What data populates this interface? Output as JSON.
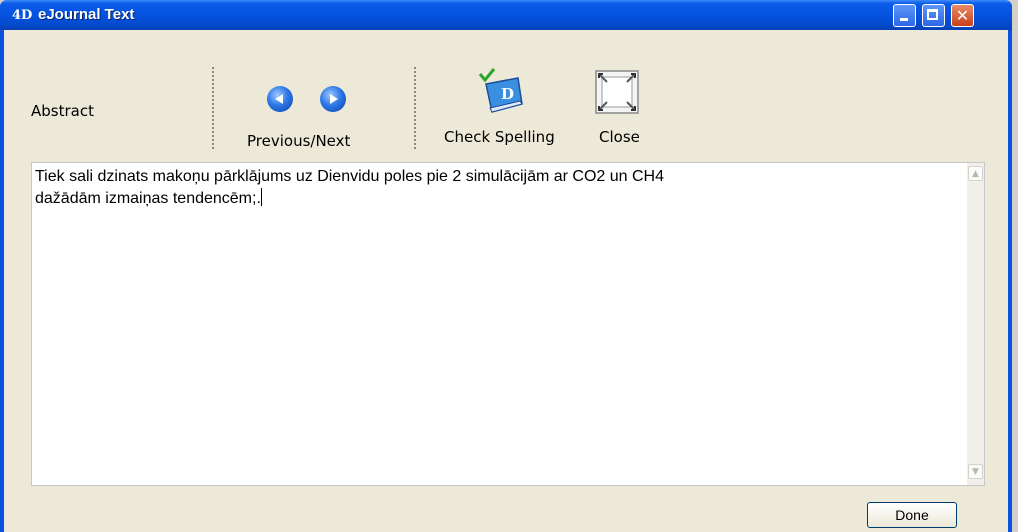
{
  "window": {
    "title": "eJournal Text",
    "app_icon": "4D",
    "close_glyph": "✕"
  },
  "toolbar": {
    "section_label": "Abstract",
    "prev_next_label": "Previous/Next",
    "check_spelling_label": "Check Spelling",
    "close_label": "Close"
  },
  "editor": {
    "text": "Tiek sali dzinats makoņu pārklājums uz Dienvidu poles pie 2 simulācijām ar CO2 un CH4\ndažādām izmaiņas tendencēm;."
  },
  "footer": {
    "done_label": "Done"
  },
  "icons": {
    "scroll_up": "▲",
    "scroll_down": "▼"
  },
  "colors": {
    "titlebar": "#0553e0",
    "client": "#ece9d8",
    "close_button": "#c8401a",
    "accent_blue": "#2d78e8"
  }
}
